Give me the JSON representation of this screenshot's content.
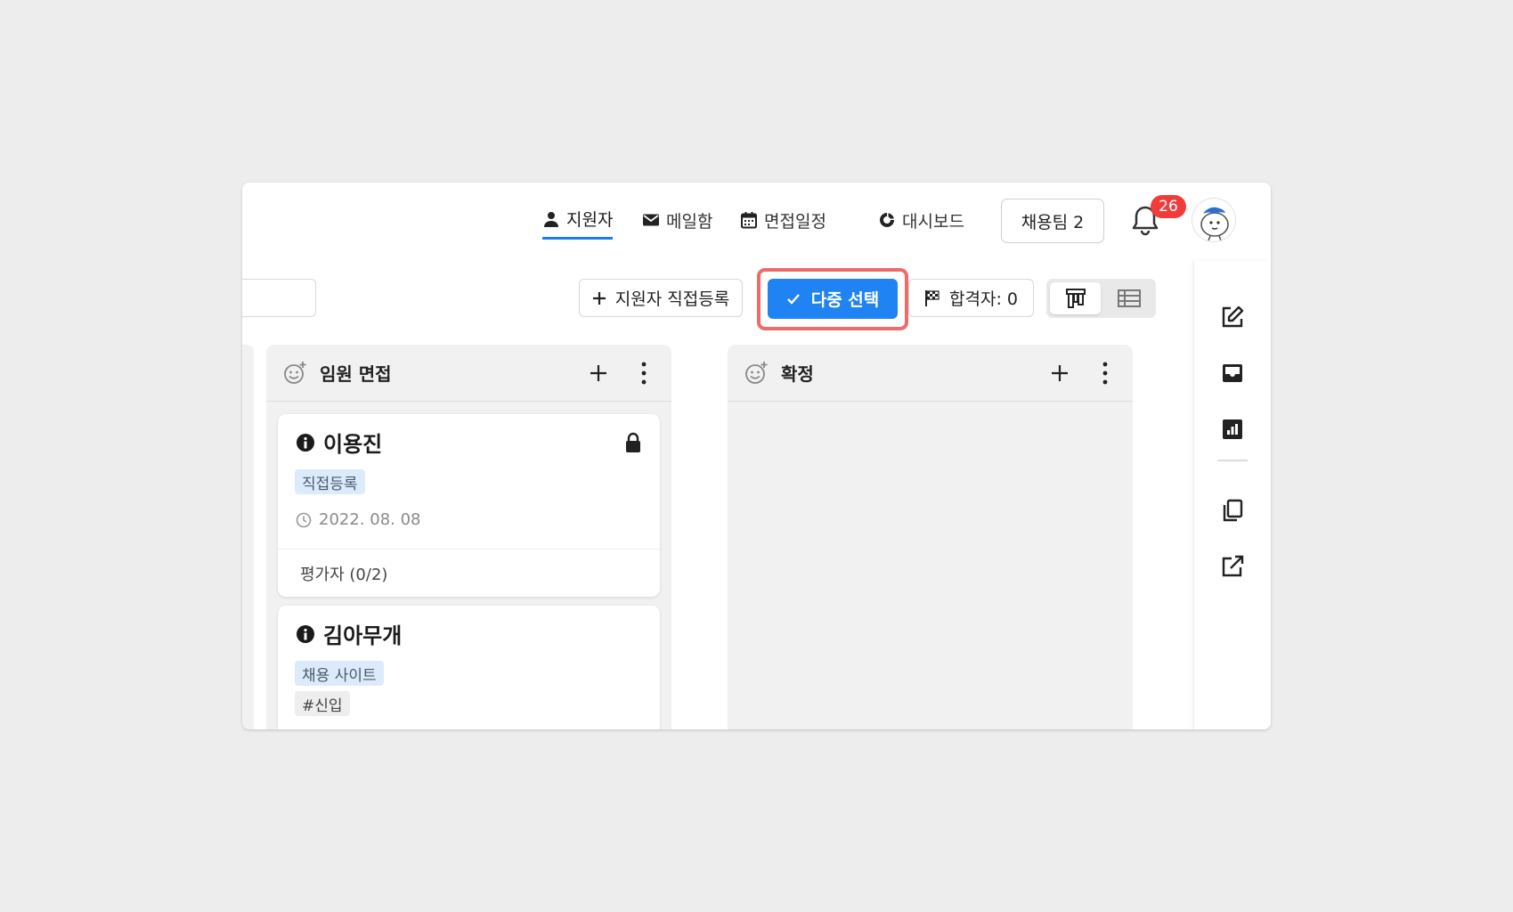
{
  "nav": {
    "items": [
      {
        "label": "지원자",
        "icon": "person-icon",
        "active": true
      },
      {
        "label": "메일함",
        "icon": "mail-icon",
        "active": false
      },
      {
        "label": "면접일정",
        "icon": "calendar-icon",
        "active": false
      },
      {
        "label": "대시보드",
        "icon": "dashboard-icon",
        "active": false
      }
    ],
    "team_label": "채용팀 2",
    "notification_count": "26"
  },
  "toolbar": {
    "add_applicant_label": "지원자 직접등록",
    "multi_select_label": "다중 선택",
    "passed_label": "합격자: 0"
  },
  "columns": [
    {
      "title": "임원 면접",
      "cards": [
        {
          "name": "이용진",
          "tags": [
            "직접등록"
          ],
          "date": "2022. 08. 08",
          "evaluators": "평가자 (0/2)",
          "locked": true
        },
        {
          "name": "김아무개",
          "tags": [
            "채용 사이트",
            "#신입"
          ]
        }
      ]
    },
    {
      "title": "확정",
      "cards": []
    }
  ],
  "colors": {
    "accent": "#1f83f3",
    "highlight": "#ef6b6b",
    "badge": "#f23c3c",
    "tag_blue": "#dcebfb"
  }
}
